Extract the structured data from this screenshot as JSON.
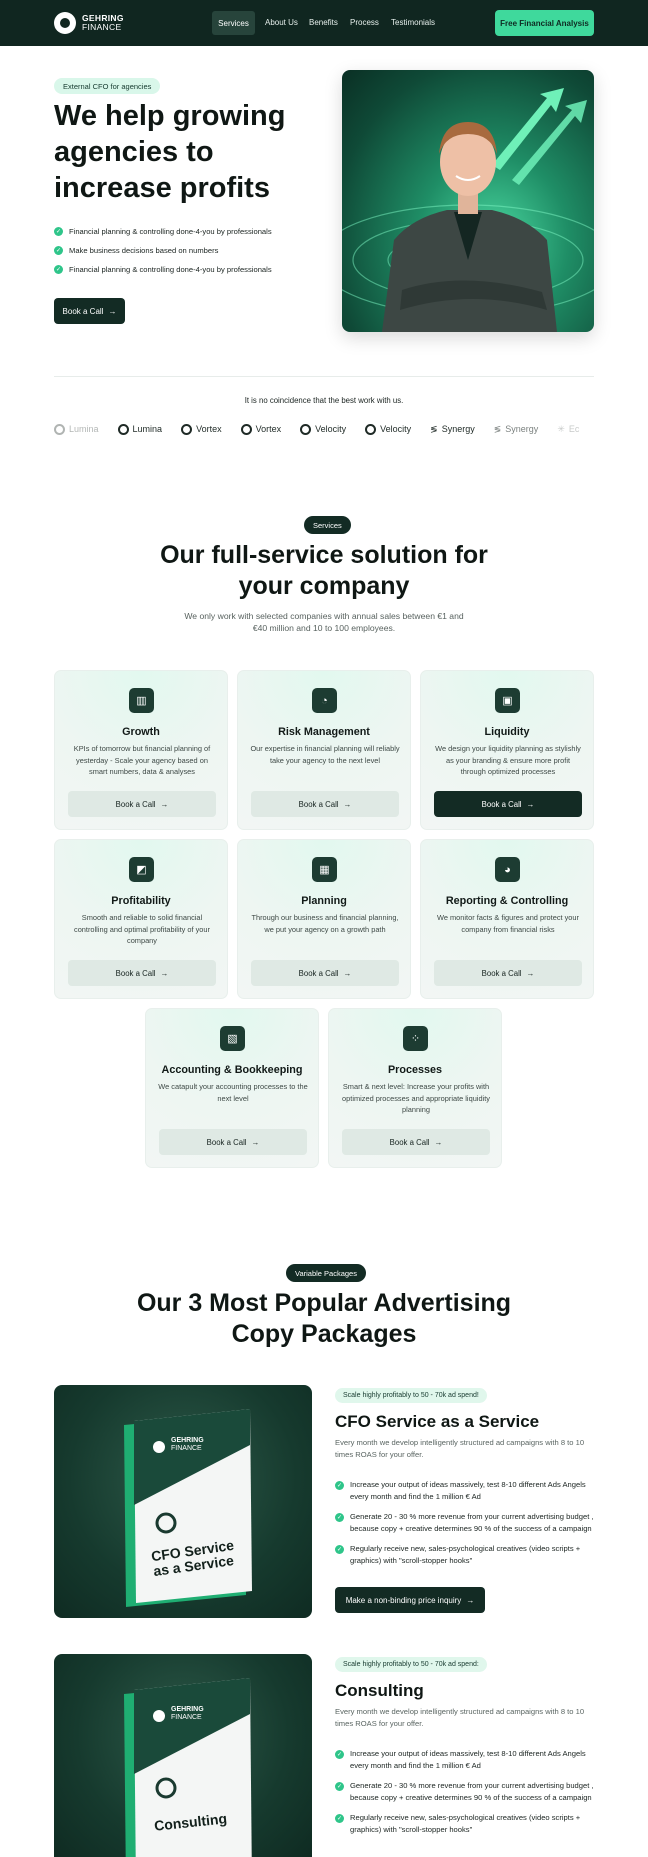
{
  "nav": {
    "logo_line1": "GEHRING",
    "logo_line2": "FINANCE",
    "links": [
      "Services",
      "About Us",
      "Benefits",
      "Process",
      "Testimonials"
    ],
    "cta": "Free Financial Analysis"
  },
  "hero": {
    "badge": "External CFO for agencies",
    "title": "We help growing agencies to increase profits",
    "checks": [
      "Financial planning & controlling done-4-you by professionals",
      "Make business decisions based on numbers",
      "Financial planning & controlling done-4-you by professionals"
    ],
    "button": "Book a Call",
    "arrow": "→"
  },
  "logos": {
    "caption": "It is no coincidence that the best work with us.",
    "brands": [
      "Lumina",
      "Lumina",
      "Vortex",
      "Vortex",
      "Velocity",
      "Velocity",
      "Synergy",
      "Synergy",
      "Ec"
    ]
  },
  "services": {
    "badge": "Services",
    "title": "Our full-service solution for your company",
    "subtitle": "We only work with selected companies with annual sales between €1 and €40 million and 10 to 100 employees.",
    "cards": [
      {
        "title": "Growth",
        "desc": "KPIs of tomorrow but financial planning of yesterday - Scale your agency based on smart numbers, data & analyses",
        "button": "Book a Call",
        "icon": "chart-icon"
      },
      {
        "title": "Risk Management",
        "desc": "Our expertise in financial planning will reliably take your agency to the next level",
        "button": "Book a Call",
        "icon": "gauge-icon"
      },
      {
        "title": "Liquidity",
        "desc": "We design your liquidity planning as stylishly as your branding & ensure more profit through optimized processes",
        "button": "Book a Call",
        "icon": "wallet-icon"
      },
      {
        "title": "Profitability",
        "desc": "Smooth and reliable to solid financial controlling and optimal profitability of your company",
        "button": "Book a Call",
        "icon": "trend-icon"
      },
      {
        "title": "Planning",
        "desc": "Through our business and financial planning, we put your agency on a growth path",
        "button": "Book a Call",
        "icon": "calendar-icon"
      },
      {
        "title": "Reporting & Controlling",
        "desc": "We monitor facts & figures and protect your company from financial risks",
        "button": "Book a Call",
        "icon": "pie-icon"
      },
      {
        "title": "Accounting & Bookkeeping",
        "desc": "We catapult your accounting processes to the next level",
        "button": "Book a Call",
        "icon": "calculator-icon"
      },
      {
        "title": "Processes",
        "desc": "Smart & next level: Increase your profits with optimized processes and appropriate liquidity planning",
        "button": "Book a Call",
        "icon": "grid-icon"
      }
    ]
  },
  "packages": {
    "badge": "Variable Packages",
    "title": "Our 3 Most Popular Advertising Copy Packages",
    "items": [
      {
        "pill": "Scale highly profitably to 50 - 70k ad spend!",
        "title": "CFO Service as a Service",
        "sub": "Every month we develop intelligently structured ad campaigns with 8 to 10 times ROAS for your offer.",
        "features": [
          "Increase your output of ideas massively, test 8-10 different Ads Angels every month and find the 1 million € Ad",
          "Generate 20 - 30 % more revenue from your current advertising budget , because copy + creative determines 90 % of the success of a campaign",
          "Regularly receive new, sales-psychological creatives (video scripts + graphics) with \"scroll-stopper hooks\""
        ],
        "button": "Make a non-binding price inquiry",
        "book_brand1": "GEHRING",
        "book_brand2": "FINANCE",
        "book_title": "CFO Service as a Service"
      },
      {
        "pill": "Scale highly profitably to 50 - 70k ad spend:",
        "title": "Consulting",
        "sub": "Every month we develop intelligently structured ad campaigns with 8 to 10 times ROAS for your offer.",
        "features": [
          "Increase your output of ideas massively, test 8-10 different Ads Angels every month and find the 1 million € Ad",
          "Generate 20 - 30 % more revenue from your current advertising budget , because copy + creative determines 90 % of the success of a campaign",
          "Regularly receive new, sales-psychological creatives (video scripts + graphics) with \"scroll-stopper hooks\""
        ],
        "book_brand1": "GEHRING",
        "book_brand2": "FINANCE",
        "book_title": "Consulting"
      }
    ]
  }
}
